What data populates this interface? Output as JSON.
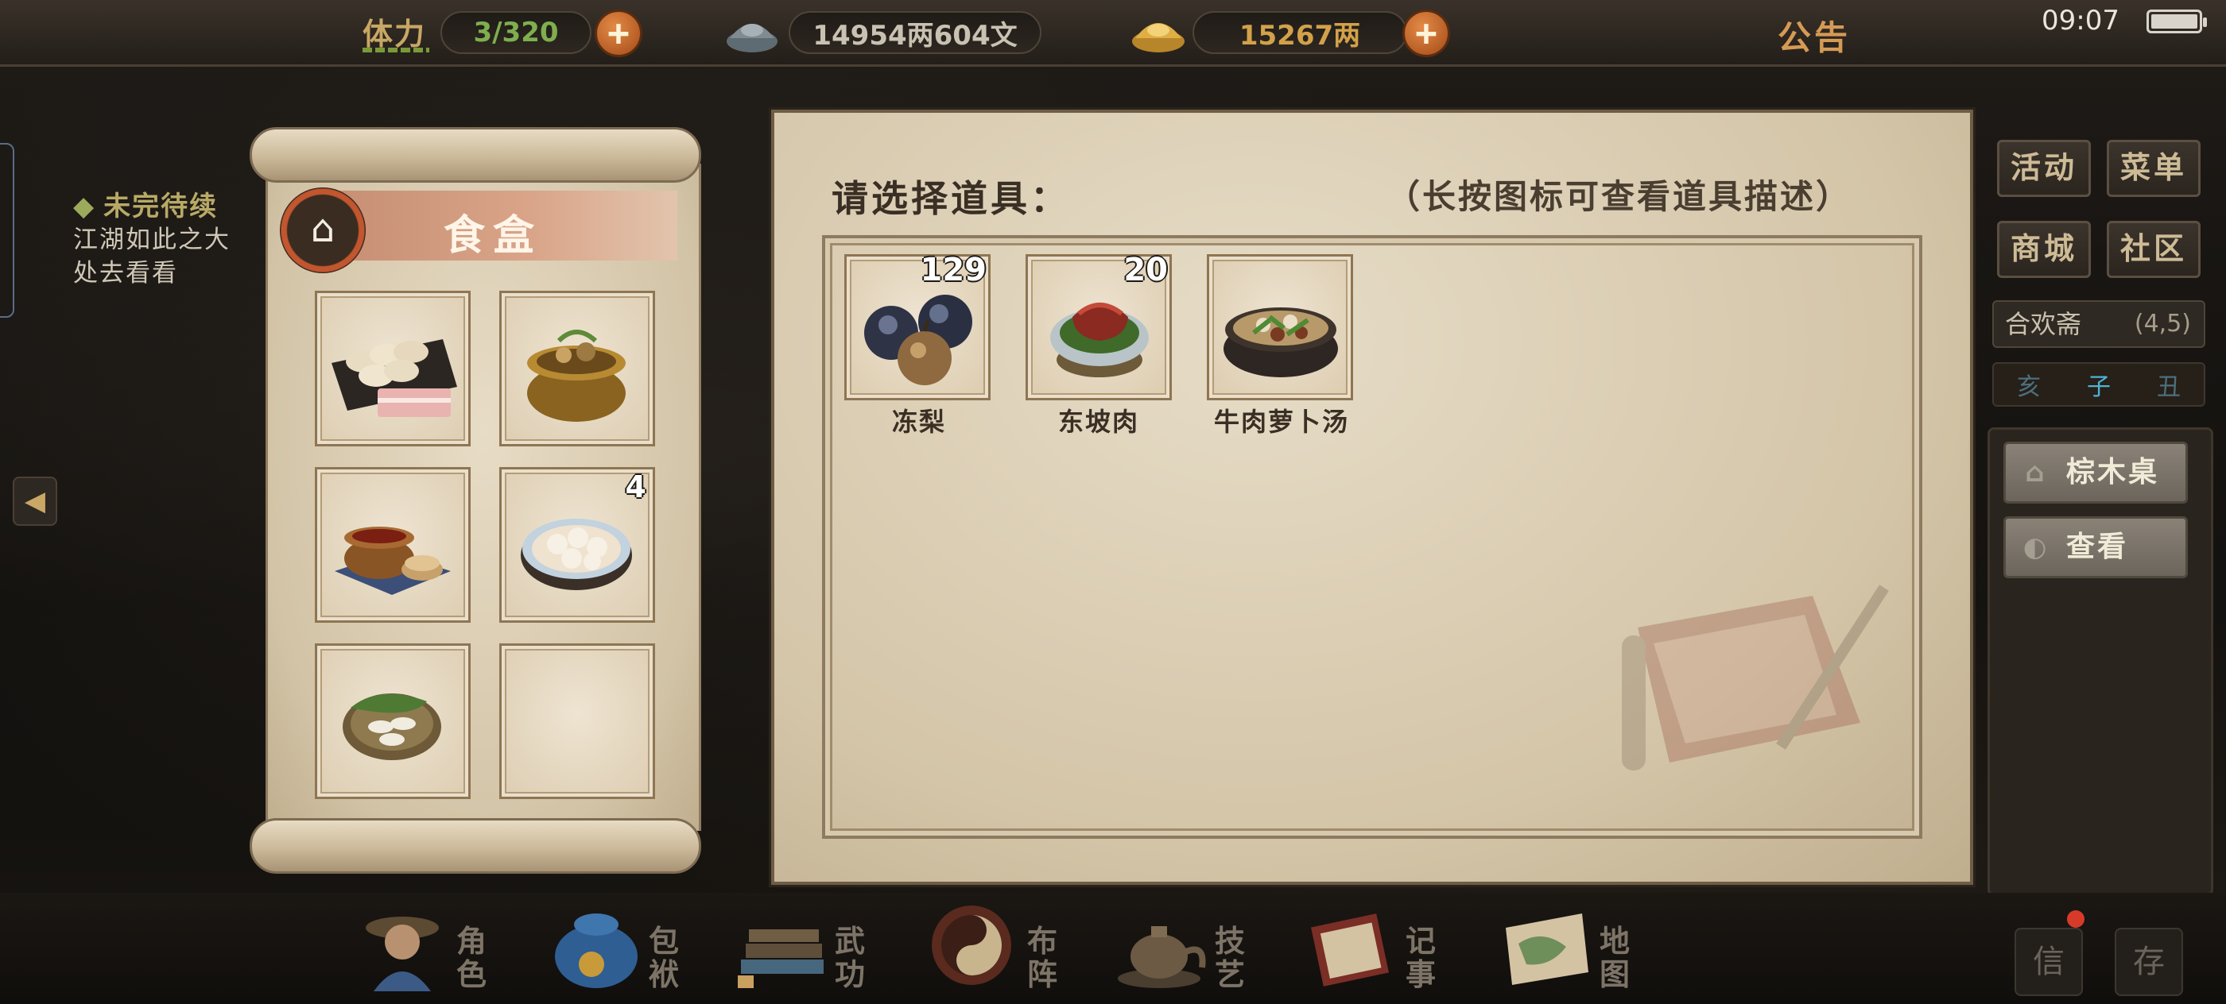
{
  "topbar": {
    "stamina_label": "体力",
    "stamina_value": "3/320",
    "copper_value": "14954两604文",
    "gold_value": "15267两",
    "notice_label": "公告",
    "clock": "09:07",
    "battery_level_percent": 90
  },
  "quest": {
    "title": "未完待续",
    "lines": [
      "江湖如此之大",
      "处去看看"
    ]
  },
  "food_box": {
    "title": "食盒",
    "slots": [
      {
        "icon": "dumplings-icon",
        "count": ""
      },
      {
        "icon": "clay-pot-stew-icon",
        "count": ""
      },
      {
        "icon": "braised-pot-icon",
        "count": ""
      },
      {
        "icon": "rice-balls-bowl-icon",
        "count": "4"
      },
      {
        "icon": "zongzi-plate-icon",
        "count": ""
      },
      {
        "icon": "",
        "count": ""
      }
    ]
  },
  "select_panel": {
    "prompt": "请选择道具：",
    "hint": "（长按图标可查看道具描述）",
    "items": [
      {
        "name": "冻梨",
        "count": "129",
        "icon": "frozen-pear-icon"
      },
      {
        "name": "东坡肉",
        "count": "20",
        "icon": "dongpo-pork-icon"
      },
      {
        "name": "牛肉萝卜汤",
        "count": "",
        "icon": "beef-radish-soup-icon"
      }
    ]
  },
  "side_menu": {
    "activity": "活动",
    "menu": "菜单",
    "mall": "商城",
    "community": "社区",
    "location_name": "合欢斋",
    "location_coord": "(4,5)",
    "time_prev": "亥",
    "time_now": "子",
    "time_next": "丑",
    "table_btn": "棕木桌",
    "view_btn": "查看"
  },
  "bottom_nav": [
    {
      "label": "角色",
      "icon": "character-icon"
    },
    {
      "label": "包袱",
      "icon": "bag-icon"
    },
    {
      "label": "武功",
      "icon": "martial-arts-icon"
    },
    {
      "label": "布阵",
      "icon": "formation-icon"
    },
    {
      "label": "技艺",
      "icon": "craft-icon"
    },
    {
      "label": "记事",
      "icon": "journal-icon"
    },
    {
      "label": "地图",
      "icon": "map-icon"
    }
  ],
  "corner": {
    "mail": "信",
    "save": "存"
  },
  "colors": {
    "accent_orange": "#c2562e",
    "panel_paper": "#d4c5a8",
    "gold_text": "#c8a765"
  }
}
